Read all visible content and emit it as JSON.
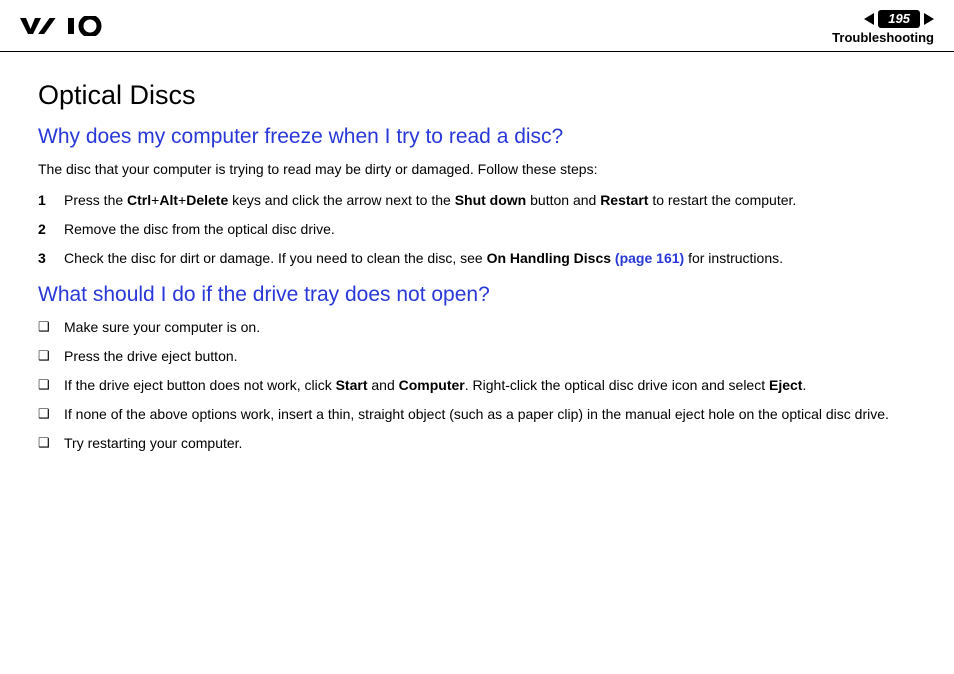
{
  "header": {
    "page_number": "195",
    "section": "Troubleshooting"
  },
  "title": "Optical Discs",
  "q1": {
    "heading": "Why does my computer freeze when I try to read a disc?",
    "intro": "The disc that your computer is trying to read may be dirty or damaged. Follow these steps:",
    "steps": {
      "s1": {
        "a": "Press the ",
        "b1": "Ctrl",
        "plus1": "+",
        "b2": "Alt",
        "plus2": "+",
        "b3": "Delete",
        "c": " keys and click the arrow next to the ",
        "b4": "Shut down",
        "d": " button and ",
        "b5": "Restart",
        "e": " to restart the computer."
      },
      "s2": "Remove the disc from the optical disc drive.",
      "s3": {
        "a": "Check the disc for dirt or damage. If you need to clean the disc, see ",
        "b1": "On Handling Discs",
        "link": " (page 161)",
        "c": " for instructions."
      }
    }
  },
  "q2": {
    "heading": "What should I do if the drive tray does not open?",
    "bullets": {
      "b1": "Make sure your computer is on.",
      "b2": "Press the drive eject button.",
      "b3": {
        "a": "If the drive eject button does not work, click ",
        "bold1": "Start",
        "b": " and ",
        "bold2": "Computer",
        "c": ". Right-click the optical disc drive icon and select ",
        "bold3": "Eject",
        "d": "."
      },
      "b4": "If none of the above options work, insert a thin, straight object (such as a paper clip) in the manual eject hole on the optical disc drive.",
      "b5": "Try restarting your computer."
    }
  }
}
